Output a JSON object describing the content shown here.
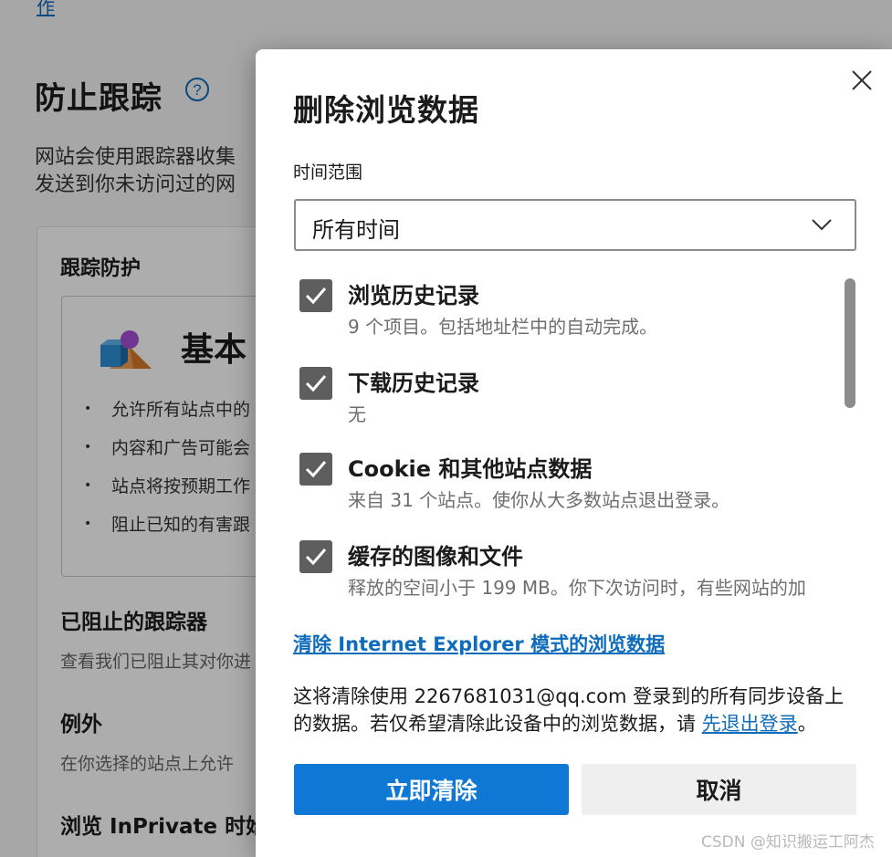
{
  "background": {
    "top_link": "作",
    "section_title": "防止跟踪",
    "help_icon": "help-circle-icon",
    "description_line1": "网站会使用跟踪器收集",
    "description_line2": "发送到你未访问过的网",
    "card_heading": "跟踪防护",
    "level_title": "基本",
    "level_icon": "shapes-icon",
    "bullets": [
      "允许所有站点中的",
      "内容和广告可能会",
      "站点将按预期工作",
      "阻止已知的有害跟"
    ],
    "blocked_title": "已阻止的跟踪器",
    "blocked_desc": "查看我们已阻止其对你进",
    "exceptions_title": "例外",
    "exceptions_desc": "在你选择的站点上允许",
    "inprivate_title": "浏览 InPrivate 时始"
  },
  "dialog": {
    "title": "删除浏览数据",
    "close_icon": "close-icon",
    "time_range_label": "时间范围",
    "time_range_value": "所有时间",
    "items": [
      {
        "label": "浏览历史记录",
        "desc": "9 个项目。包括地址栏中的自动完成。",
        "checked": true
      },
      {
        "label": "下载历史记录",
        "desc": "无",
        "checked": true
      },
      {
        "label": "Cookie 和其他站点数据",
        "desc": "来自 31 个站点。使你从大多数站点退出登录。",
        "checked": true
      },
      {
        "label": "缓存的图像和文件",
        "desc": "释放的空间小于 199 MB。你下次访问时，有些网站的加",
        "checked": true
      }
    ],
    "ie_link": "清除 Internet Explorer 模式的浏览数据",
    "sync_note_prefix": "这将清除使用 2267681031@qq.com 登录到的所有同步设备上的数据。若仅希望清除此设备中的浏览数据，请 ",
    "sync_note_link": "先退出登录",
    "sync_note_suffix": "。",
    "primary_button": "立即清除",
    "secondary_button": "取消"
  },
  "watermark": "CSDN @知识搬运工阿杰",
  "colors": {
    "accent": "#0f78d4",
    "link": "#0f6cbd",
    "checkbox": "#5e5e5e"
  }
}
